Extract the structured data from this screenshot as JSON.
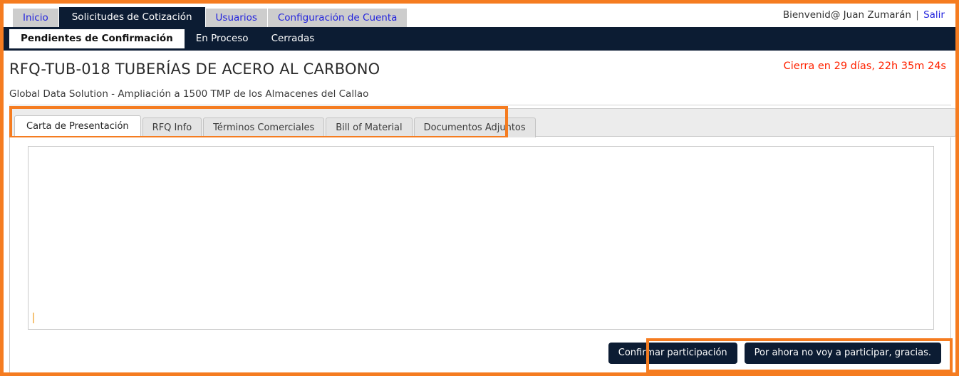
{
  "window": {
    "accent_orange": "#f57c20",
    "nav_dark": "#0c1c33",
    "link_blue": "#2222dd",
    "alert_red": "#ff2200"
  },
  "topnav": {
    "tabs": [
      {
        "label": "Inicio",
        "active": false
      },
      {
        "label": "Solicitudes de Cotización",
        "active": true
      },
      {
        "label": "Usuarios",
        "active": false
      },
      {
        "label": "Configuración de Cuenta",
        "active": false
      }
    ],
    "welcome_text": "Bienvenid@ Juan Zumarán",
    "separator": "|",
    "logout_label": "Salir"
  },
  "subnav": {
    "tabs": [
      {
        "label": "Pendientes de Confirmación",
        "active": true
      },
      {
        "label": "En Proceso",
        "active": false
      },
      {
        "label": "Cerradas",
        "active": false
      }
    ]
  },
  "header": {
    "title": "RFQ-TUB-018 TUBERÍAS DE ACERO AL CARBONO",
    "subtitle": "Global Data Solution - Ampliación a 1500 TMP de los Almacenes del Callao",
    "countdown": "Cierra en 29 días, 22h 35m 24s"
  },
  "doc_tabs": {
    "tabs": [
      {
        "label": "Carta de Presentación",
        "active": true
      },
      {
        "label": "RFQ Info",
        "active": false
      },
      {
        "label": "Términos Comerciales",
        "active": false
      },
      {
        "label": "Bill of Material",
        "active": false
      },
      {
        "label": "Documentos Adjuntos",
        "active": false
      }
    ]
  },
  "editor": {
    "value": "",
    "placeholder": ""
  },
  "actions": {
    "confirm_label": "Confirmar participación",
    "decline_label": "Por ahora no voy a participar, gracias."
  }
}
